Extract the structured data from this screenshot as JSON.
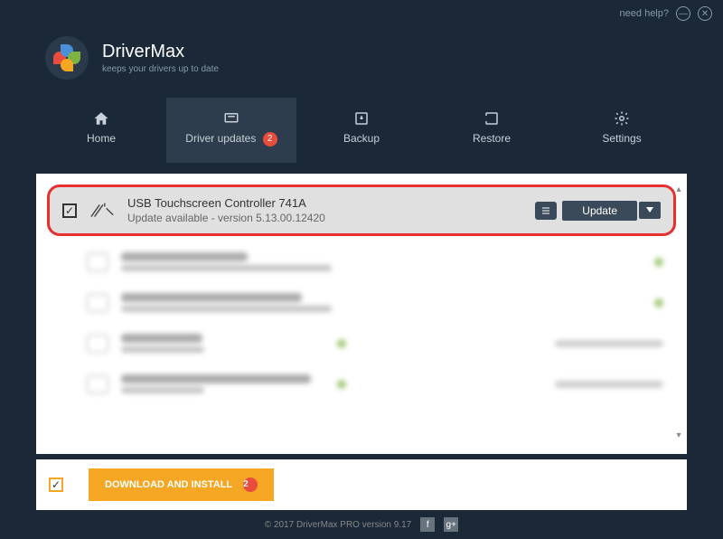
{
  "titlebar": {
    "help": "need help?"
  },
  "brand": {
    "name": "DriverMax",
    "tagline": "keeps your drivers up to date"
  },
  "tabs": {
    "home": "Home",
    "updates": "Driver updates",
    "updates_badge": "2",
    "backup": "Backup",
    "restore": "Restore",
    "settings": "Settings"
  },
  "driver": {
    "name": "USB Touchscreen Controller 741A",
    "status": "Update available - version 5.13.00.12420",
    "update_btn": "Update"
  },
  "blurred": [
    {
      "w1": 140
    },
    {
      "w1": 200
    },
    {
      "w1": 90,
      "right": true
    },
    {
      "w1": 210,
      "right": true
    }
  ],
  "bottom": {
    "download": "DOWNLOAD AND INSTALL",
    "badge": "2"
  },
  "footer": {
    "copyright": "© 2017 DriverMax PRO version 9.17"
  }
}
